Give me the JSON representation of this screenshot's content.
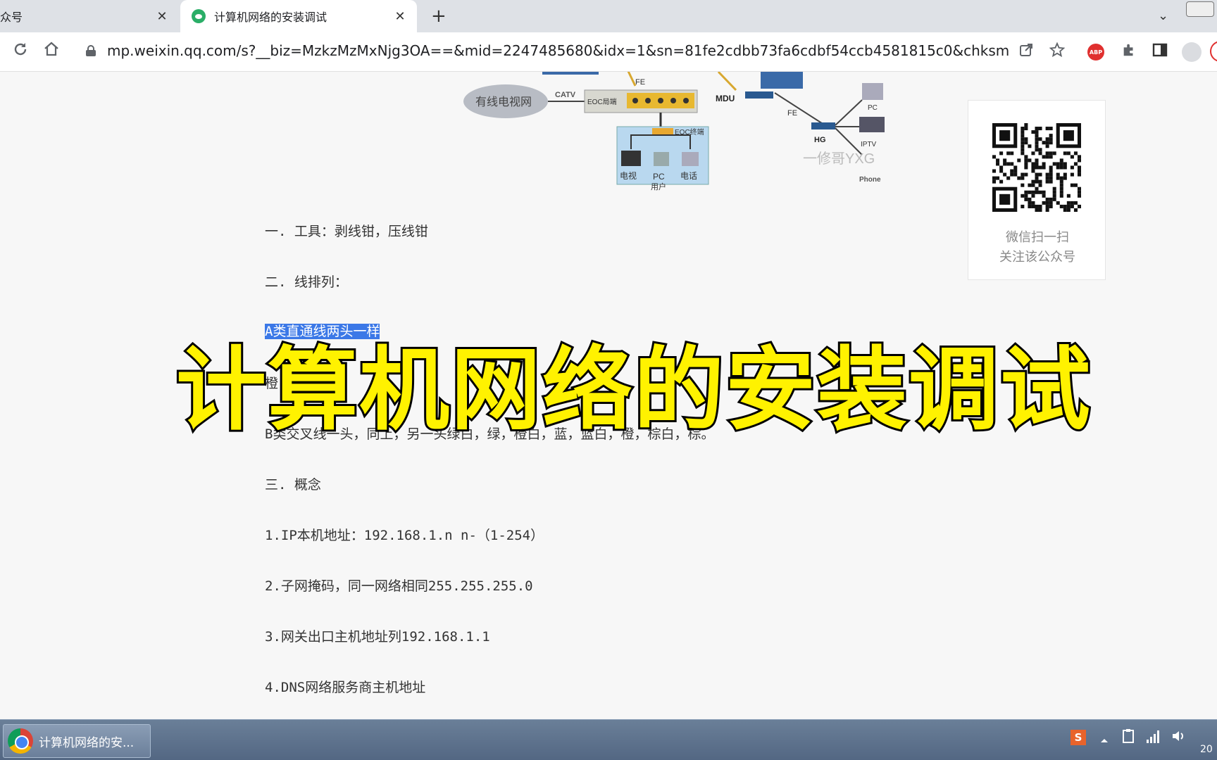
{
  "browser": {
    "tabs": [
      {
        "label": "众号",
        "active": false
      },
      {
        "label": "计算机网络的安装调试",
        "active": true
      }
    ],
    "close_glyph": "✕",
    "new_tab_glyph": "+",
    "tab_menu_glyph": "⌄",
    "url": "mp.weixin.qq.com/s?__biz=MzkzMzMxNjg3OA==&mid=2247485680&idx=1&sn=81fe2cdbb73fa6cdbf54ccb4581815c0&chksm=c24f1...",
    "icons": [
      "reload-icon",
      "home-icon",
      "lock-icon",
      "share-icon",
      "star-icon",
      "adblock-icon",
      "extensions-icon",
      "sidepanel-icon",
      "profile-icon"
    ],
    "abp_text": "ABP"
  },
  "diagram": {
    "labels": {
      "catv_cloud": "有线电视网",
      "catv": "CATV",
      "eoc_head": "EOC局端",
      "eoc_term": "EOC终端",
      "tv": "电视",
      "pc": "PC",
      "phone": "电话",
      "user": "用户",
      "mdu": "MDU",
      "fe1": "FE",
      "fe2": "FE",
      "hg": "HG",
      "pc2": "PC",
      "iptv": "IPTV",
      "phone2": "Phone",
      "watermark": "一修哥YXG"
    }
  },
  "article": {
    "p1": "一. 工具：剥线钳，压线钳",
    "p2": "二. 线排列：",
    "p3_highlight": "A类直通线两头一样",
    "p4": "橙",
    "p5": "B类交叉线一头，同上，另一头绿白，绿，橙白，蓝，蓝白，橙，棕白，棕。",
    "p6": "三. 概念",
    "p7": "1.IP本机地址：192.168.1.n n-（1-254）",
    "p8": "2.子网掩码，同一网络相同255.255.255.0",
    "p9": "3.网关出口主机地址列192.168.1.1",
    "p10": "4.DNS网络服务商主机地址"
  },
  "qr_card": {
    "line1": "微信扫一扫",
    "line2": "关注该公众号"
  },
  "overlay_title": "计算机网络的安装调试",
  "taskbar": {
    "task_label": "计算机网络的安...",
    "tray_s": "S",
    "clock": "20"
  },
  "colors": {
    "highlight": "#3b78e7",
    "overlay_fill": "#fff200",
    "overlay_stroke": "#000000",
    "taskbar": "#536783",
    "wechat_green": "#2aae67"
  }
}
